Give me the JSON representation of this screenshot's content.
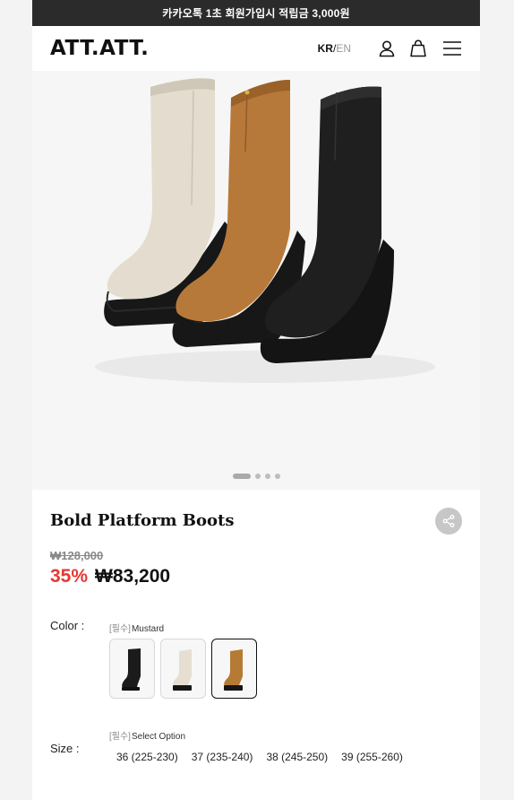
{
  "topbar": {
    "promo": "카카오톡 1초 회원가입시 적립금 3,000원"
  },
  "header": {
    "logo": "ATT.ATT.",
    "lang_kr": "KR",
    "lang_sep": "/",
    "lang_en": "EN",
    "icons": [
      "user-icon",
      "shopping-bag-icon",
      "menu-icon"
    ]
  },
  "hero": {
    "slide_count": 4,
    "active_slide": 1
  },
  "product": {
    "title": "Bold Platform Boots",
    "original_price": "₩128,000",
    "discount": "35%",
    "price": "₩83,200"
  },
  "color_option": {
    "label": "Color :",
    "required_tag": "[필수]",
    "selected_value": "Mustard",
    "swatches": [
      {
        "name": "Black",
        "color": "#1b1b1b"
      },
      {
        "name": "Cream",
        "color": "#e6dfd1"
      },
      {
        "name": "Mustard",
        "color": "#b57a34"
      }
    ]
  },
  "size_option": {
    "label": "Size :",
    "required_tag": "[필수]",
    "placeholder": "Select Option",
    "sizes": [
      "36 (225-230)",
      "37 (235-240)",
      "38 (245-250)",
      "39 (255-260)"
    ]
  },
  "colors": {
    "discount": "#e53935",
    "topbar_bg": "#2b2b2b"
  }
}
